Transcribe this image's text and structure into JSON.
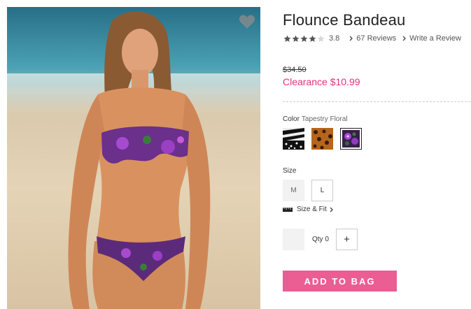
{
  "product": {
    "title": "Flounce Bandeau",
    "rating_value": 3.8,
    "rating_text": "3.8",
    "rating_stars_filled": 4,
    "reviews_link": "67 Reviews",
    "write_review_link": "Write a Review",
    "original_price": "$34.50",
    "sale_price": "Clearance $10.99"
  },
  "color": {
    "label": "Color",
    "selected_name": "Tapestry Floral",
    "swatches": [
      {
        "name": "zebra-print",
        "selected": false
      },
      {
        "name": "leopard-print",
        "selected": false
      },
      {
        "name": "tapestry-floral",
        "selected": true
      }
    ]
  },
  "size": {
    "label": "Size",
    "options": [
      {
        "label": "M",
        "available": false
      },
      {
        "label": "L",
        "available": true
      }
    ],
    "fit_link": "Size & Fit"
  },
  "quantity": {
    "label": "Qty 0",
    "plus": "+"
  },
  "add_to_bag": "ADD TO BAG",
  "icons": {
    "favorite": "heart-icon",
    "rating": "star-icon",
    "ruler": "ruler-icon",
    "chevron": "chevron-right-icon"
  },
  "colors": {
    "accent_pink": "#e0327d",
    "button_pink": "#ea5e94",
    "star_grey": "#555555"
  }
}
